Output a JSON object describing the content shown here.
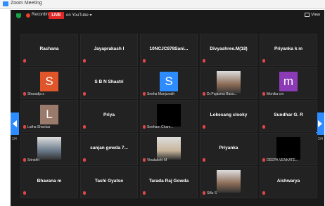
{
  "window": {
    "title": "Zoom Meeting"
  },
  "topbar": {
    "recording_label": "Recording",
    "live_label": "LIVE",
    "youtube_label": "on YouTube ▾",
    "view_label": "View"
  },
  "nav": {
    "page_left": "1/4",
    "page_right": "2/4"
  },
  "colors": {
    "live": "#e02828",
    "accent": "#2d8cff",
    "mute": "#e14646"
  },
  "tiles": [
    {
      "name": "Rachana",
      "tag": ""
    },
    {
      "name": "Jayaprakash I",
      "tag": ""
    },
    {
      "name": "10NCJC878Sani...",
      "tag": ""
    },
    {
      "name": "Divyashree.M(18)",
      "tag": ""
    },
    {
      "name": "Priyanka k m",
      "tag": ""
    },
    {
      "avatar": "S",
      "avatar_color": "#e0552a",
      "tag": "Sharadja s"
    },
    {
      "name": "S B N Shastri",
      "tag": ""
    },
    {
      "avatar": "S",
      "avatar_color": "#2d8cff",
      "tag": "Sneha Manjunath"
    },
    {
      "photo": "person-photo",
      "tag": "Dr.Pajasma Basu..."
    },
    {
      "avatar": "m",
      "avatar_color": "#8b3bb5",
      "tag": "Monika cm"
    },
    {
      "avatar": "L",
      "avatar_color": "#9a7a6a",
      "tag": "Latha Shankar"
    },
    {
      "name": "Priya",
      "tag": ""
    },
    {
      "black": true,
      "tag": "Sneham Cham..."
    },
    {
      "name": "Lokesang clooky",
      "tag": ""
    },
    {
      "name": "Sundhar G. R",
      "tag": ""
    },
    {
      "photo": "person-photo",
      "tag": "Srinidhi"
    },
    {
      "name": "sanjan gowda 7...",
      "tag": ""
    },
    {
      "photo": "person-photo",
      "tag": "Vinalakshi M"
    },
    {
      "name": "Priyanka",
      "tag": ""
    },
    {
      "black": true,
      "tag": "DEEPA VENKATE..."
    },
    {
      "name": "Bhavana m",
      "tag": ""
    },
    {
      "name": "Tashi Gyatso",
      "tag": ""
    },
    {
      "name": "Tarada Raj Gowda",
      "tag": ""
    },
    {
      "photo": "person-photo",
      "tag": "Sillu S"
    },
    {
      "name": "Aishwarya",
      "tag": ""
    }
  ]
}
